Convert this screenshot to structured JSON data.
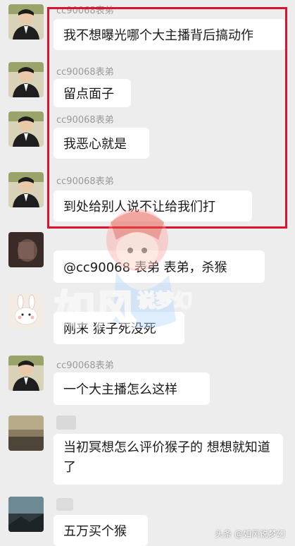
{
  "messages": [
    {
      "sender": "cc90068表弟",
      "text": "我不想曝光哪个大主播背后搞动作"
    },
    {
      "sender": "cc90068表弟",
      "text": "留点面子"
    },
    {
      "sender": "cc90068表弟",
      "text": "我恶心就是"
    },
    {
      "sender": "cc90068表弟",
      "text": "到处给别人说不让给我们打"
    },
    {
      "sender": "",
      "text": "@cc90068 表弟  表弟，杀猴"
    },
    {
      "sender": "",
      "text": "刚来 猴子死没死"
    },
    {
      "sender": "cc90068表弟",
      "text": "一个大主播怎么这样"
    },
    {
      "sender": "",
      "text": "当初冥想怎么评价猴子的 想想就知道了"
    },
    {
      "sender": "",
      "text": "五万买个猴"
    }
  ],
  "watermark": {
    "main": "如风",
    "sub": "说梦幻"
  },
  "footer": "头条 @如风说梦幻",
  "colors": {
    "highlight_border": "#e0122b",
    "background": "#ededed",
    "bubble": "#ffffff",
    "sender": "#9a9a9a"
  }
}
